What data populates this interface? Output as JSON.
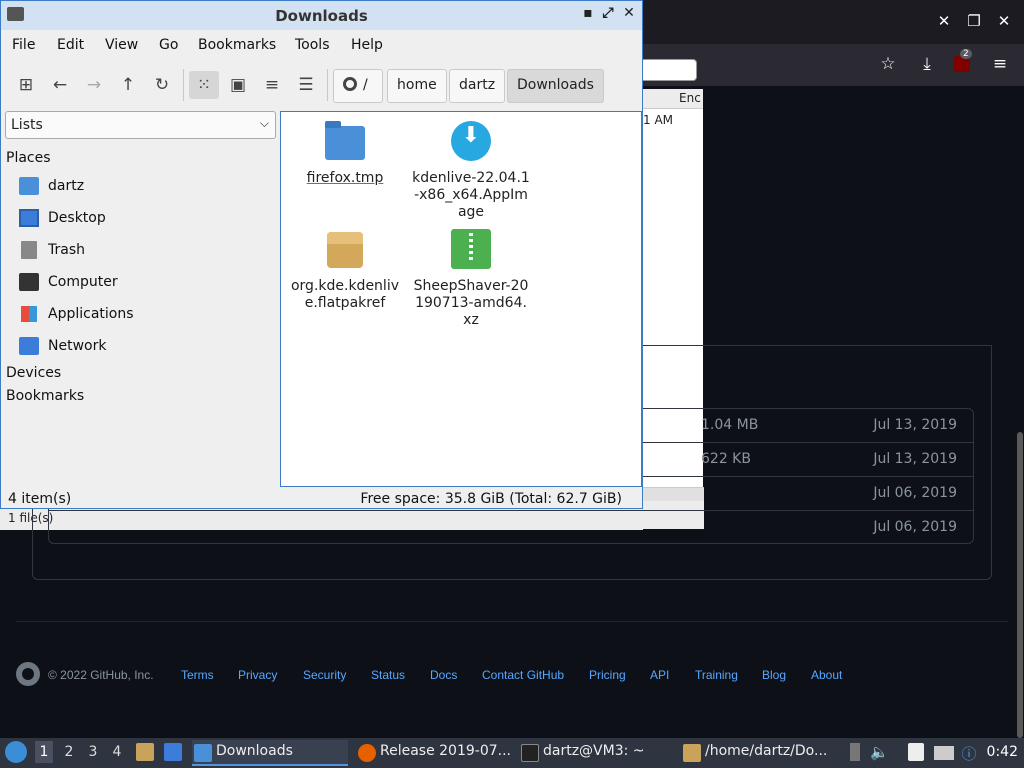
{
  "browser": {
    "download_badge": "2",
    "behind_table": {
      "column_header": "Enc",
      "time_fragment": "1 AM"
    },
    "behind_status": "1 file(s)",
    "assets": [
      {
        "size": "1.04 MB",
        "date": "Jul 13, 2019"
      },
      {
        "size": "622 KB",
        "date": "Jul 13, 2019"
      },
      {
        "size": "",
        "date": "Jul 06, 2019"
      },
      {
        "size": "",
        "date": "Jul 06, 2019"
      }
    ],
    "footer": {
      "copyright": "© 2022 GitHub, Inc.",
      "links": [
        "Terms",
        "Privacy",
        "Security",
        "Status",
        "Docs",
        "Contact GitHub",
        "Pricing",
        "API",
        "Training",
        "Blog",
        "About"
      ]
    }
  },
  "fm": {
    "title": "Downloads",
    "menu": [
      "File",
      "Edit",
      "View",
      "Go",
      "Bookmarks",
      "Tools",
      "Help"
    ],
    "path_root": "/",
    "breadcrumbs": [
      "home",
      "dartz",
      "Downloads"
    ],
    "side_select": "Lists",
    "places_heading": "Places",
    "places": [
      {
        "label": "dartz",
        "icon": "home-folder-icon"
      },
      {
        "label": "Desktop",
        "icon": "desktop-icon"
      },
      {
        "label": "Trash",
        "icon": "trash-icon"
      },
      {
        "label": "Computer",
        "icon": "computer-icon"
      },
      {
        "label": "Applications",
        "icon": "applications-icon"
      },
      {
        "label": "Network",
        "icon": "network-icon"
      }
    ],
    "devices_heading": "Devices",
    "bookmarks_heading": "Bookmarks",
    "files": [
      {
        "name": "firefox.tmp",
        "icon": "folder-icon"
      },
      {
        "name": "kdenlive-22.04.1-x86_x64.AppImage",
        "icon": "appimage-icon"
      },
      {
        "name": "org.kde.kdenlive.flatpakref",
        "icon": "package-icon"
      },
      {
        "name": "SheepShaver-20190713-amd64.xz",
        "icon": "archive-icon"
      }
    ],
    "status_count": "4 item(s)",
    "status_free": "Free space: 35.8 GiB (Total: 62.7 GiB)"
  },
  "taskbar": {
    "workspaces": [
      "1",
      "2",
      "3",
      "4"
    ],
    "tasks": [
      "Downloads",
      "Release 2019-07...",
      "dartz@VM3: ~",
      "/home/dartz/Do..."
    ],
    "clock": "0:42"
  },
  "colors": {
    "accent": "#3d7bc7",
    "github_link": "#58a6ff",
    "taskbar_bg": "#2e3440"
  }
}
